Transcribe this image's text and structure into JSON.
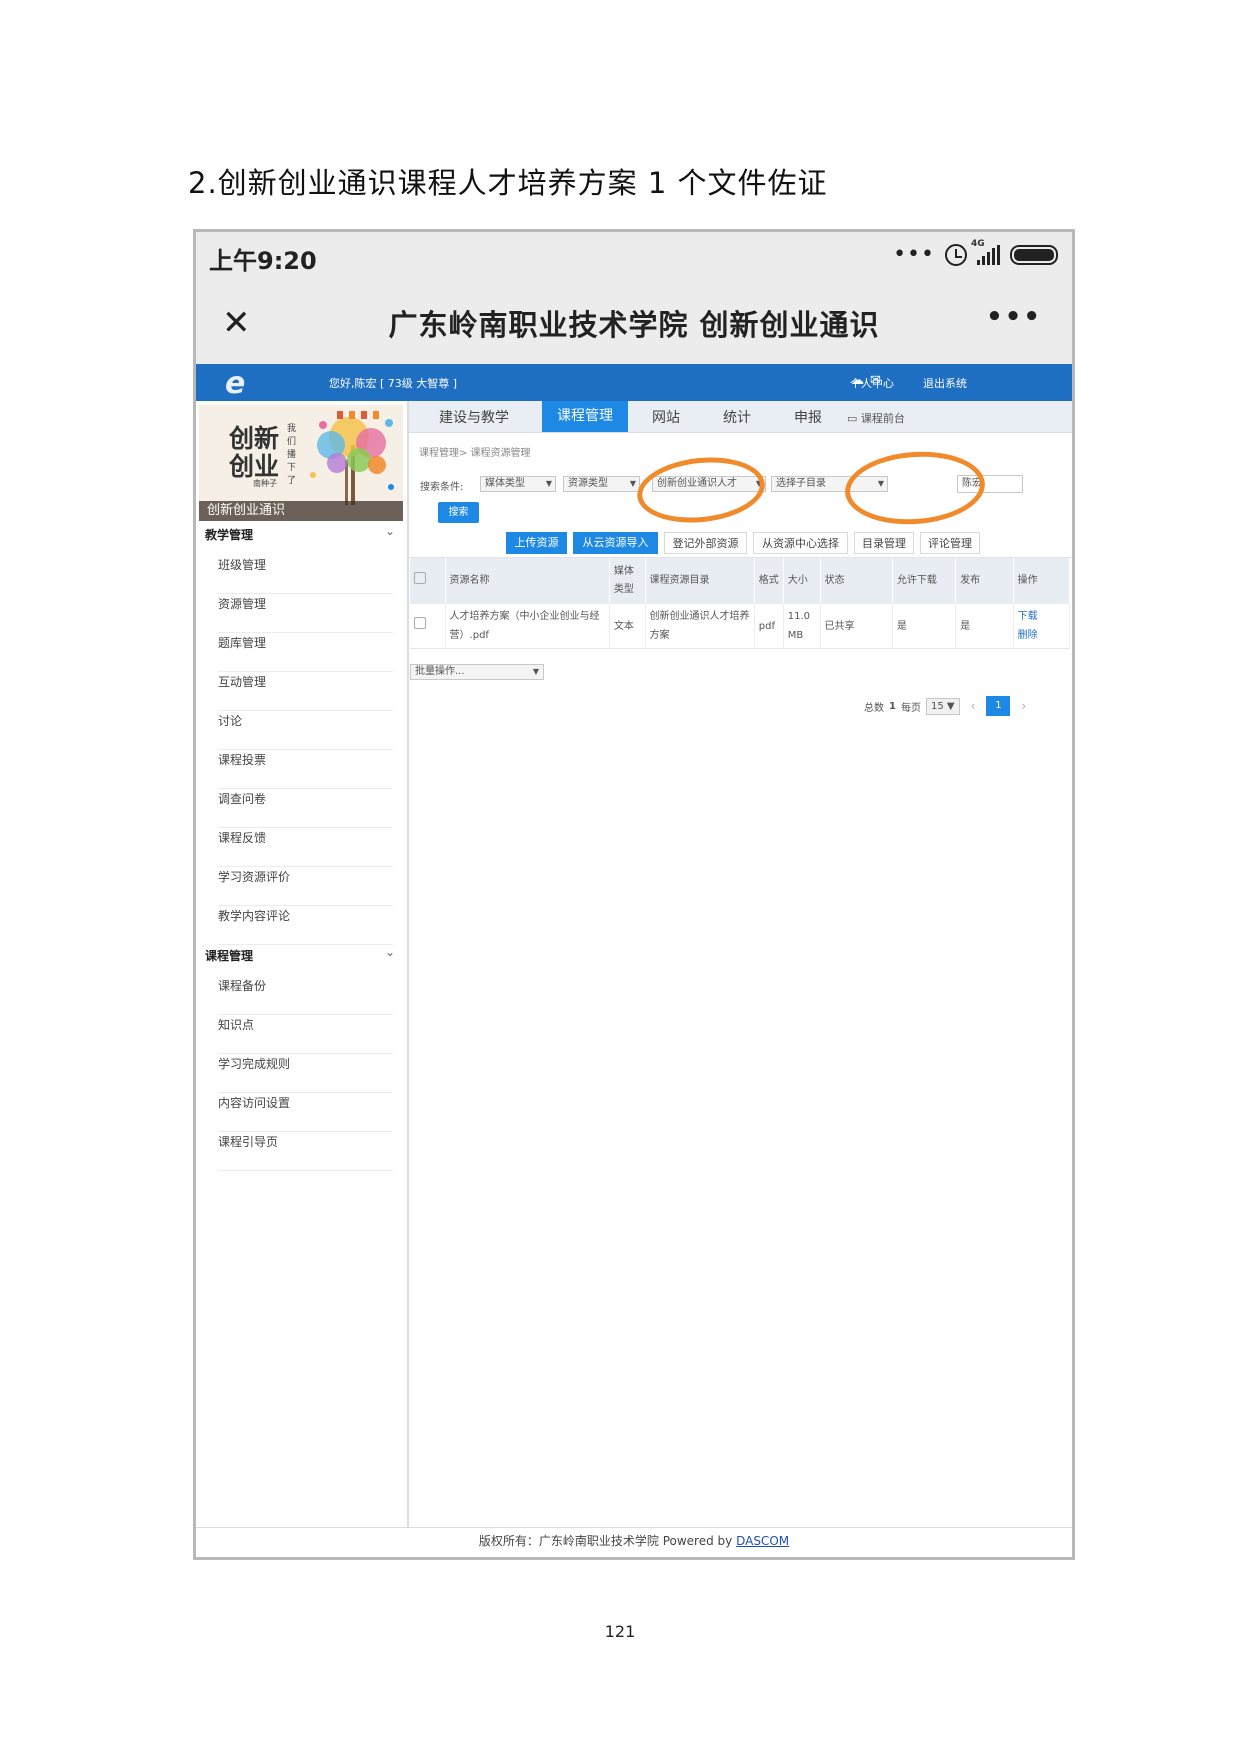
{
  "document": {
    "heading": "2.创新创业通识课程人才培养方案 1 个文件佐证",
    "page_number": "121"
  },
  "phone": {
    "time": "上午9:20",
    "network_label": "4G",
    "icons": [
      "more-dots-icon",
      "alarm-icon",
      "signal-icon",
      "battery-icon"
    ]
  },
  "app": {
    "close_symbol": "✕",
    "title": "广东岭南职业技术学院 创新创业通识",
    "more_symbol": "•••"
  },
  "topbar": {
    "greeting": "您好,陈宏 [ 73级 大智尊 ]",
    "personal_center": "个人中心",
    "logout": "退出系统"
  },
  "sidebar": {
    "banner_line1": "创新",
    "banner_line2": "创业",
    "banner_small": "我们播下了",
    "banner_small2": "南种子",
    "banner_caption": "创新创业通识",
    "sections": [
      {
        "title": "教学管理",
        "items": [
          "班级管理",
          "资源管理",
          "题库管理",
          "互动管理",
          "讨论",
          "课程投票",
          "调查问卷",
          "课程反馈",
          "学习资源评价",
          "教学内容评论"
        ]
      },
      {
        "title": "课程管理",
        "items": [
          "课程备份",
          "知识点",
          "学习完成规则",
          "内容访问设置",
          "课程引导页"
        ]
      }
    ]
  },
  "tabs": [
    "建设与教学",
    "课程管理",
    "网站",
    "统计",
    "申报"
  ],
  "active_tab": "课程管理",
  "course_front": "课程前台",
  "breadcrumb": "课程管理> 课程资源管理",
  "search": {
    "label": "搜索条件:",
    "media_type": "媒体类型",
    "resource_type": "资源类型",
    "catalog": "创新创业通识人才",
    "sub_catalog": "选择子目录",
    "keyword": "陈宏",
    "button": "搜索"
  },
  "actions": {
    "upload": "上传资源",
    "cloud_import": "从云资源导入",
    "register_external": "登记外部资源",
    "center_select": "从资源中心选择",
    "catalog_manage": "目录管理",
    "comment_manage": "评论管理"
  },
  "table": {
    "headers": {
      "name": "资源名称",
      "media_type": "媒体类型",
      "catalog": "课程资源目录",
      "format": "格式",
      "size": "大小",
      "status": "状态",
      "allow_download": "允许下载",
      "publish": "发布",
      "operation": "操作"
    },
    "rows": [
      {
        "name": "人才培养方案（中小企业创业与经营）.pdf",
        "media_type": "文本",
        "catalog": "创新创业通识人才培养方案",
        "format": "pdf",
        "size": "11.0 MB",
        "status": "已共享",
        "allow_download": "是",
        "publish": "是",
        "op_download": "下载",
        "op_delete": "删除"
      }
    ]
  },
  "batch_select": "批量操作...",
  "pager": {
    "total_label": "总数",
    "total": "1",
    "per_page_label": "每页",
    "per_page": "15",
    "current": "1"
  },
  "footer": {
    "text": "版权所有：广东岭南职业技术学院 Powered by",
    "brand": "DASCOM"
  },
  "colors": {
    "primary": "#1e88e5",
    "header_blue": "#1e6fc2",
    "highlight_circle": "#f08a2a"
  }
}
